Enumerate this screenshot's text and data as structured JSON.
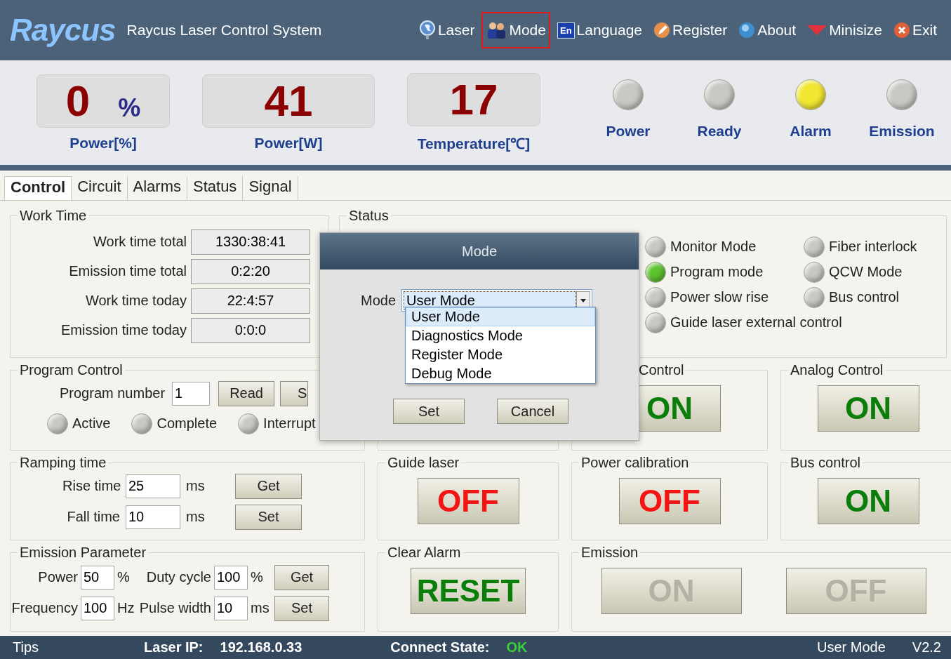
{
  "header": {
    "logo": "Raycus",
    "title": "Raycus Laser Control System",
    "menu": [
      {
        "label": "Laser",
        "kind": "globe",
        "selected": false
      },
      {
        "label": "Mode",
        "kind": "people",
        "selected": true
      },
      {
        "label": "Language",
        "kind": "lang",
        "icon_text": "En",
        "selected": false
      },
      {
        "label": "Register",
        "kind": "pen",
        "selected": false
      },
      {
        "label": "About",
        "kind": "info",
        "selected": false
      },
      {
        "label": "Minisize",
        "kind": "down",
        "selected": false
      },
      {
        "label": "Exit",
        "kind": "exit",
        "selected": false
      }
    ]
  },
  "readouts": [
    {
      "value": "0",
      "unit": "%",
      "label": "Power[%]"
    },
    {
      "value": "41",
      "label": "Power[W]"
    },
    {
      "value": "17",
      "label": "Temperature[℃]"
    }
  ],
  "indicators": [
    {
      "label": "Power",
      "color": "#c8c8c4"
    },
    {
      "label": "Ready",
      "color": "#c8c8c4"
    },
    {
      "label": "Alarm",
      "color": "#f2e630"
    },
    {
      "label": "Emission",
      "color": "#c8c8c4"
    }
  ],
  "tabs": [
    {
      "label": "Control",
      "selected": true
    },
    {
      "label": "Circuit",
      "selected": false
    },
    {
      "label": "Alarms",
      "selected": false
    },
    {
      "label": "Status",
      "selected": false
    },
    {
      "label": "Signal",
      "selected": false
    }
  ],
  "work_time": {
    "title": "Work Time",
    "rows": [
      {
        "label": "Work time total",
        "value": "1330:38:41"
      },
      {
        "label": "Emission time total",
        "value": "0:2:20"
      },
      {
        "label": "Work time today",
        "value": "22:4:57"
      },
      {
        "label": "Emission time today",
        "value": "0:0:0"
      }
    ]
  },
  "status": {
    "title": "Status",
    "lamps": [
      {
        "label": "Monitor Mode",
        "color": "#c8c8c4"
      },
      {
        "label": "Fiber interlock",
        "color": "#c8c8c4"
      },
      {
        "label": "Program mode",
        "color": "#5cc22e"
      },
      {
        "label": "QCW Mode",
        "color": "#c8c8c4"
      },
      {
        "label": "Power slow rise",
        "color": "#c8c8c4"
      },
      {
        "label": "Bus control",
        "color": "#c8c8c4"
      },
      {
        "label": "Guide laser external control",
        "color": "#c8c8c4"
      }
    ]
  },
  "program_control": {
    "title": "Program Control",
    "number_label": "Program number",
    "number": "1",
    "buttons": [
      "Read",
      "S"
    ],
    "lamps": [
      {
        "label": "Active",
        "color": "#c8c8c4"
      },
      {
        "label": "Complete",
        "color": "#c8c8c4"
      },
      {
        "label": "Interrupt",
        "color": "#c8c8c4"
      }
    ]
  },
  "ramping": {
    "title": "Ramping time",
    "rows": [
      {
        "label": "Rise time",
        "value": "25",
        "unit": "ms",
        "button": "Get"
      },
      {
        "label": "Fall time",
        "value": "10",
        "unit": "ms",
        "button": "Set"
      }
    ]
  },
  "emission_parameter": {
    "title": "Emission Parameter",
    "rows": [
      {
        "fields": [
          {
            "label": "Power",
            "value": "50",
            "unit": "%"
          },
          {
            "label": "Duty cycle",
            "value": "100",
            "unit": "%"
          }
        ],
        "button": "Get"
      },
      {
        "fields": [
          {
            "label": "Frequency",
            "value": "100",
            "unit": "Hz"
          },
          {
            "label": "Pulse width",
            "value": "10",
            "unit": "ms"
          }
        ],
        "button": "Set"
      }
    ]
  },
  "switch_groups": [
    {
      "title": "Control",
      "buttons": [
        {
          "label": "ON",
          "kind": "on",
          "disabled": false
        }
      ]
    },
    {
      "title": "Analog Control",
      "buttons": [
        {
          "label": "ON",
          "kind": "on",
          "disabled": false
        }
      ]
    },
    {
      "title": "Guide laser",
      "buttons": [
        {
          "label": "OFF",
          "kind": "off",
          "disabled": false
        }
      ]
    },
    {
      "title": "Power  calibration",
      "buttons": [
        {
          "label": "OFF",
          "kind": "off",
          "disabled": false
        }
      ]
    },
    {
      "title": "Bus control",
      "buttons": [
        {
          "label": "ON",
          "kind": "on",
          "disabled": false
        }
      ]
    },
    {
      "title": "Clear Alarm",
      "buttons": [
        {
          "label": "RESET",
          "kind": "on",
          "disabled": false
        }
      ]
    },
    {
      "title": "Emission",
      "buttons": [
        {
          "label": "ON",
          "kind": "on",
          "disabled": true
        },
        {
          "label": "OFF",
          "kind": "off",
          "disabled": true
        }
      ]
    }
  ],
  "dialog": {
    "title": "Mode",
    "field_label": "Mode",
    "value": "User Mode",
    "options": [
      {
        "label": "User Mode",
        "selected": true
      },
      {
        "label": "Diagnostics Mode",
        "selected": false
      },
      {
        "label": "Register Mode",
        "selected": false
      },
      {
        "label": "Debug Mode",
        "selected": false
      }
    ],
    "buttons": [
      "Set",
      "Cancel"
    ]
  },
  "status_bar": {
    "tips": "Tips",
    "ip_label": "Laser IP:",
    "ip": "192.168.0.33",
    "connect_label": "Connect State:",
    "connect": "OK",
    "mode": "User Mode",
    "version": "V2.2"
  }
}
